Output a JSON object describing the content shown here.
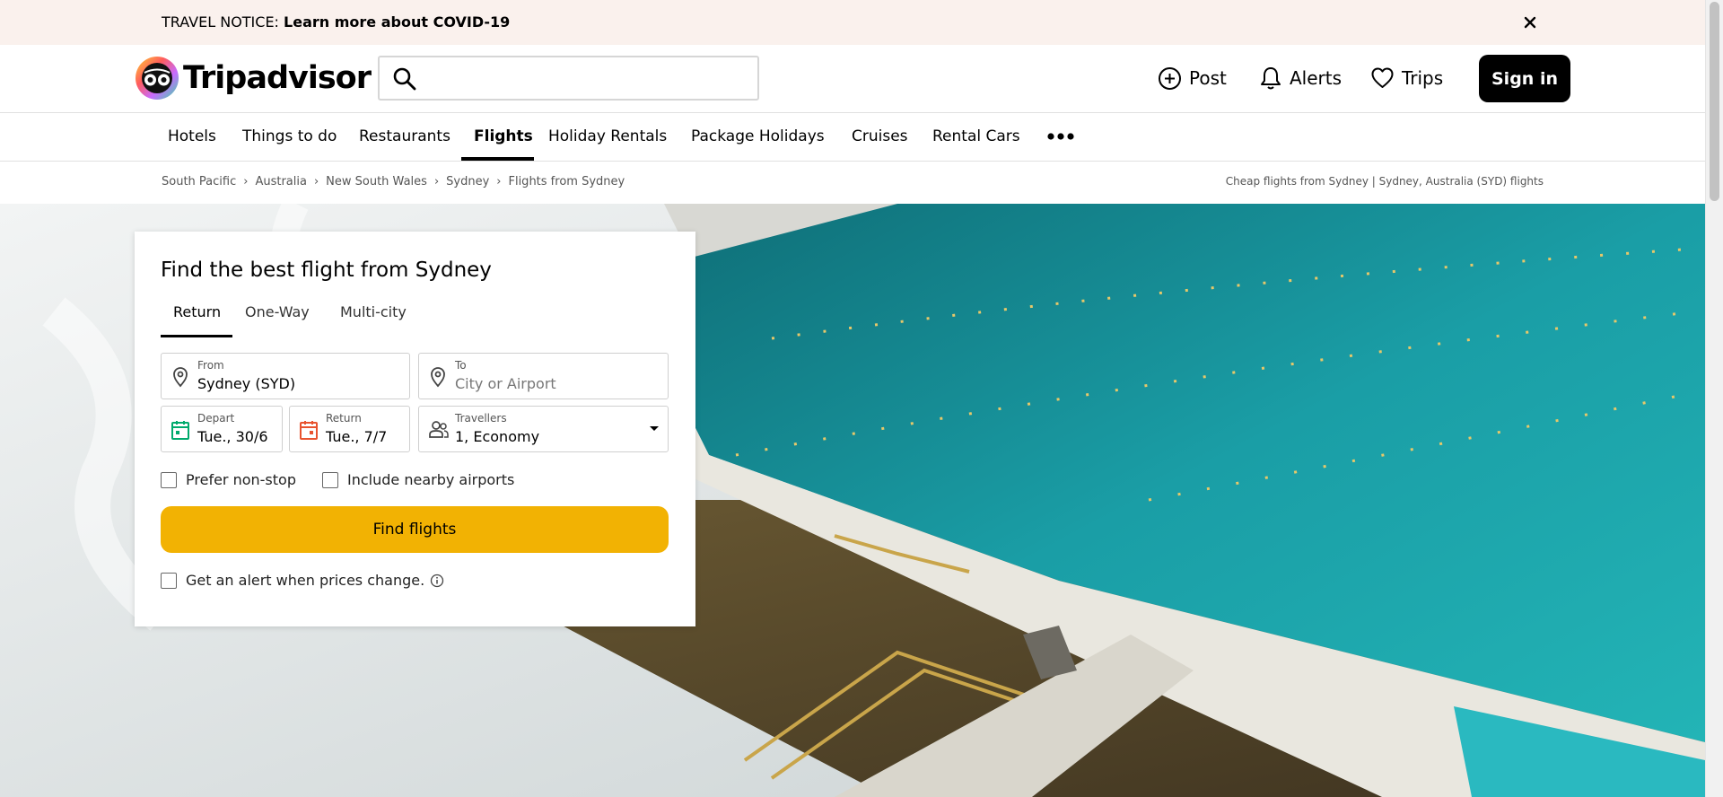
{
  "notice": {
    "prefix": "TRAVEL NOTICE:",
    "link": "Learn more about COVID-19"
  },
  "header": {
    "logo_text": "Tripadvisor",
    "search": {
      "value": "",
      "placeholder": ""
    },
    "post_label": "Post",
    "alerts_label": "Alerts",
    "trips_label": "Trips",
    "signin_label": "Sign in"
  },
  "nav": {
    "items": [
      "Hotels",
      "Things to do",
      "Restaurants",
      "Flights",
      "Holiday Rentals",
      "Package Holidays",
      "Cruises",
      "Rental Cars"
    ],
    "active": "Flights"
  },
  "breadcrumb": {
    "items": [
      "South Pacific",
      "Australia",
      "New South Wales",
      "Sydney",
      "Flights from Sydney"
    ],
    "right_text": "Cheap flights from Sydney | Sydney, Australia (SYD) flights"
  },
  "search_card": {
    "title": "Find the best flight from Sydney",
    "tabs": [
      "Return",
      "One-Way",
      "Multi-city"
    ],
    "active_tab": "Return",
    "from": {
      "label": "From",
      "value": "Sydney (SYD)"
    },
    "to": {
      "label": "To",
      "placeholder": "City or Airport"
    },
    "depart": {
      "label": "Depart",
      "value": "Tue., 30/6"
    },
    "return": {
      "label": "Return",
      "value": "Tue., 7/7"
    },
    "travellers": {
      "label": "Travellers",
      "value": "1, Economy"
    },
    "prefer_nonstop": {
      "label": "Prefer non-stop",
      "checked": false
    },
    "nearby_airports": {
      "label": "Include nearby airports",
      "checked": false
    },
    "find_button": "Find flights",
    "price_alert": {
      "label": "Get an alert when prices change.",
      "checked": false
    }
  },
  "colors": {
    "notice_bg": "#faf1ed",
    "find_button": "#f2b203",
    "depart_icon": "#00aa6c",
    "return_icon": "#e8532f",
    "signin_bg": "#000000"
  }
}
